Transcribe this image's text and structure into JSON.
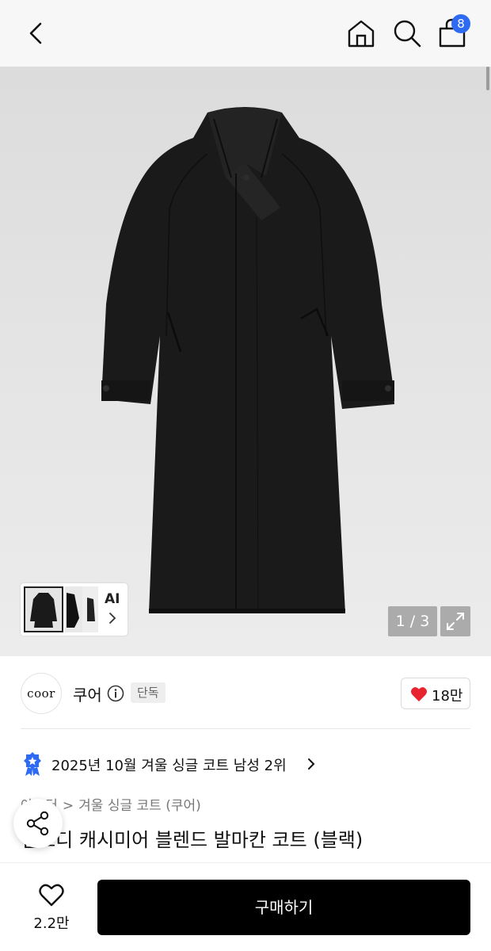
{
  "header": {
    "cart_count": "8"
  },
  "gallery": {
    "ai_label": "AI",
    "counter": "1 / 3"
  },
  "brand": {
    "logo_text": "coor",
    "name": "쿠어",
    "exclusive_badge": "단독",
    "likes": "18만"
  },
  "ranking": {
    "text": "2025년 10월 겨울 싱글 코트 남성 2위"
  },
  "breadcrumb": {
    "items": [
      "아우터",
      "겨울 싱글 코트 (쿠어)"
    ]
  },
  "product": {
    "title": "벨로디 캐시미어 블렌드 발마칸 코트 (블랙)"
  },
  "bottom_bar": {
    "wish_count": "2.2만",
    "buy_label": "구매하기"
  },
  "colors": {
    "accent_blue": "#2f6bf2",
    "heart_red": "#e8232f",
    "buy_button": "#000000"
  }
}
